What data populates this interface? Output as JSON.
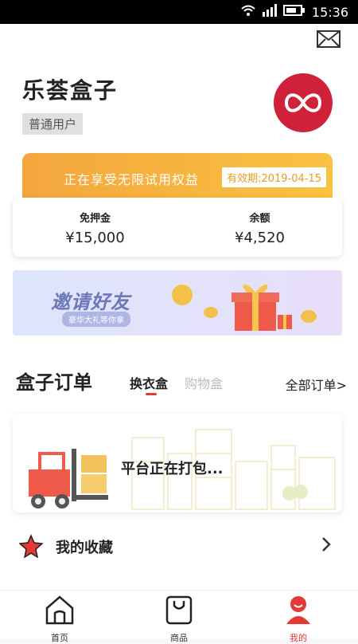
{
  "status_bar": {
    "time": "15:36"
  },
  "header": {
    "app_name": "乐荟盒子",
    "user_level": "普通用户"
  },
  "promo": {
    "text": "正在享受无限试用权益",
    "validity": "有效期:2019-04-15"
  },
  "balance": {
    "deposit_free_label": "免押金",
    "deposit_free_value": "¥15,000",
    "balance_label": "余额",
    "balance_value": "¥4,520"
  },
  "invite": {
    "title": "邀请好友",
    "subtitle": "豪华大礼等你拿"
  },
  "orders": {
    "title": "盒子订单",
    "tabs": [
      {
        "label": "换衣盒"
      },
      {
        "label": "购物盒"
      }
    ],
    "all_orders": "全部订单>",
    "status": "平台正在打包..."
  },
  "favorites": {
    "label": "我的收藏"
  },
  "tabbar": {
    "items": [
      {
        "label": "首页"
      },
      {
        "label": "商品"
      },
      {
        "label": "我的"
      }
    ]
  },
  "colors": {
    "accent": "#e53935",
    "promo_gradient_start": "#f4a63d",
    "promo_gradient_end": "#f9c241",
    "logo_bg": "#d0213a"
  },
  "icons": [
    "wifi-icon",
    "signal-icon",
    "battery-icon",
    "mail-icon",
    "infinity-logo-icon",
    "star-icon",
    "chevron-right-icon",
    "home-icon",
    "shopping-bag-icon",
    "user-icon"
  ]
}
